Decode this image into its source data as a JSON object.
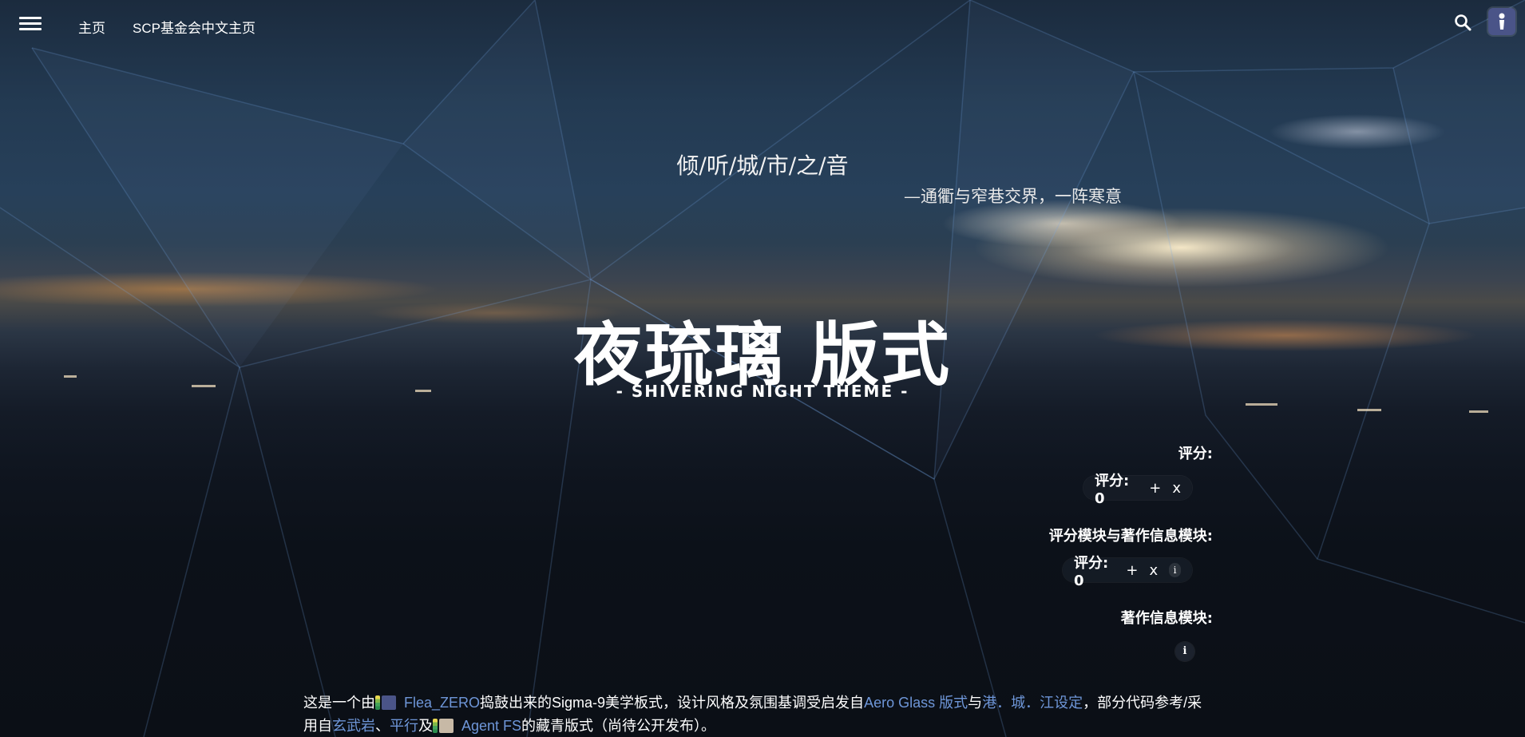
{
  "topbar": {
    "menu_icon": "hamburger-menu-icon",
    "links": [
      {
        "label": "主页"
      },
      {
        "label": "SCP基金会中文主页"
      }
    ],
    "search_icon": "search-icon",
    "avatar_icon": "user-avatar-icon"
  },
  "hero": {
    "motto": "倾/听/城/市/之/音",
    "motto_sub": "—通衢与窄巷交界，一阵寒意",
    "title": "夜琉璃 版式",
    "subtitle": "- SHIVERING NIGHT THEME -"
  },
  "modules": {
    "rating_label": "评分:",
    "rating_widget": {
      "text": "评分: 0",
      "plus": "+",
      "cancel": "x"
    },
    "rating_credit_label": "评分模块与著作信息模块:",
    "rating_credit_widget": {
      "text": "评分: 0",
      "plus": "+",
      "cancel": "x",
      "info": "i"
    },
    "credit_label": "著作信息模块:",
    "credit_info": "i"
  },
  "description": {
    "p1": "这是一个由",
    "user1": "Flea_ZERO",
    "p2": "捣鼓出来的Sigma-9美学板式，设计风格及氛围基调受启发自",
    "link1": "Aero Glass 版式",
    "p3": "与",
    "link2": "港．城．江设定",
    "p4": "，部分代码参考/采用自",
    "link3": "玄武岩",
    "p5": "、",
    "link4": "平行",
    "p6": "及",
    "user2": "Agent FS",
    "p7": "的藏青版式（尚待公开发布）。"
  }
}
